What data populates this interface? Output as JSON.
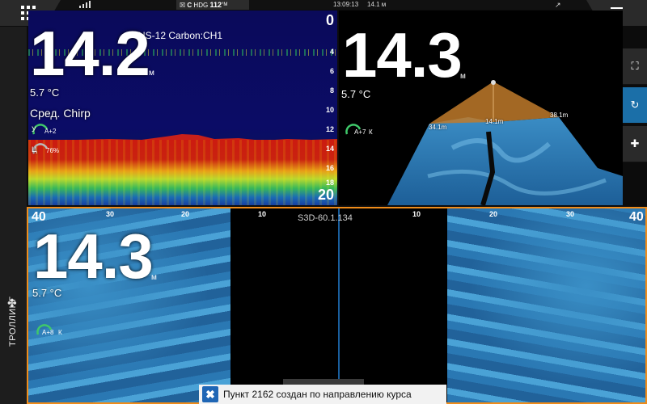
{
  "topbar": {
    "hdg_prefix": "C",
    "hdg_label": "HDG",
    "hdg_value": "112",
    "hdg_unit": "°M",
    "time": "13:09:13",
    "depth": "14.1 м"
  },
  "icons": {
    "apps": "grid-icon",
    "menu": "hamburger-icon",
    "signal": "signal-bars-icon",
    "satellite": "satellite-icon",
    "fullscreen": "fullscreen-icon",
    "rotate": "rotate-icon",
    "pan": "pan-icon",
    "toast": "close-x-icon",
    "trolling": "fan-icon"
  },
  "panel_sonar": {
    "source": "HS-12 Carbon:CH1",
    "depth_value": "14.2",
    "depth_unit": "м",
    "temperature": "5.7 °C",
    "mode": "Сред. Chirp",
    "gain_label": "У",
    "gain_value": "A+2",
    "color_label": "Ц",
    "color_value": "76%",
    "scale": [
      "0",
      "4",
      "6",
      "8",
      "10",
      "12",
      "14",
      "16",
      "18",
      "20"
    ]
  },
  "panel_3d": {
    "depth_value": "14.3",
    "depth_unit": "м",
    "temperature": "5.7 °C",
    "gain_value": "A+7",
    "gain_suffix": "К",
    "tags": [
      "34.1m",
      "14.1m",
      "38.1m"
    ]
  },
  "panel_ss": {
    "title": "S3D-60.1.134",
    "depth_value": "14.3",
    "depth_unit": "м",
    "temperature": "5.7 °C",
    "gain_value": "A+8",
    "gain_suffix": "К",
    "ticks_left": [
      "40",
      "30",
      "20",
      "10"
    ],
    "ticks_right": [
      "10",
      "20",
      "30",
      "40"
    ]
  },
  "side": {
    "mode_label": "ТРОЛЛИНГ"
  },
  "toast": {
    "message": "Пункт 2162 создан по направлению курса"
  },
  "colors": {
    "accent_orange": "#f08c1a",
    "active_blue": "#1b6fa8",
    "sonar_water": "#0b0c66"
  }
}
